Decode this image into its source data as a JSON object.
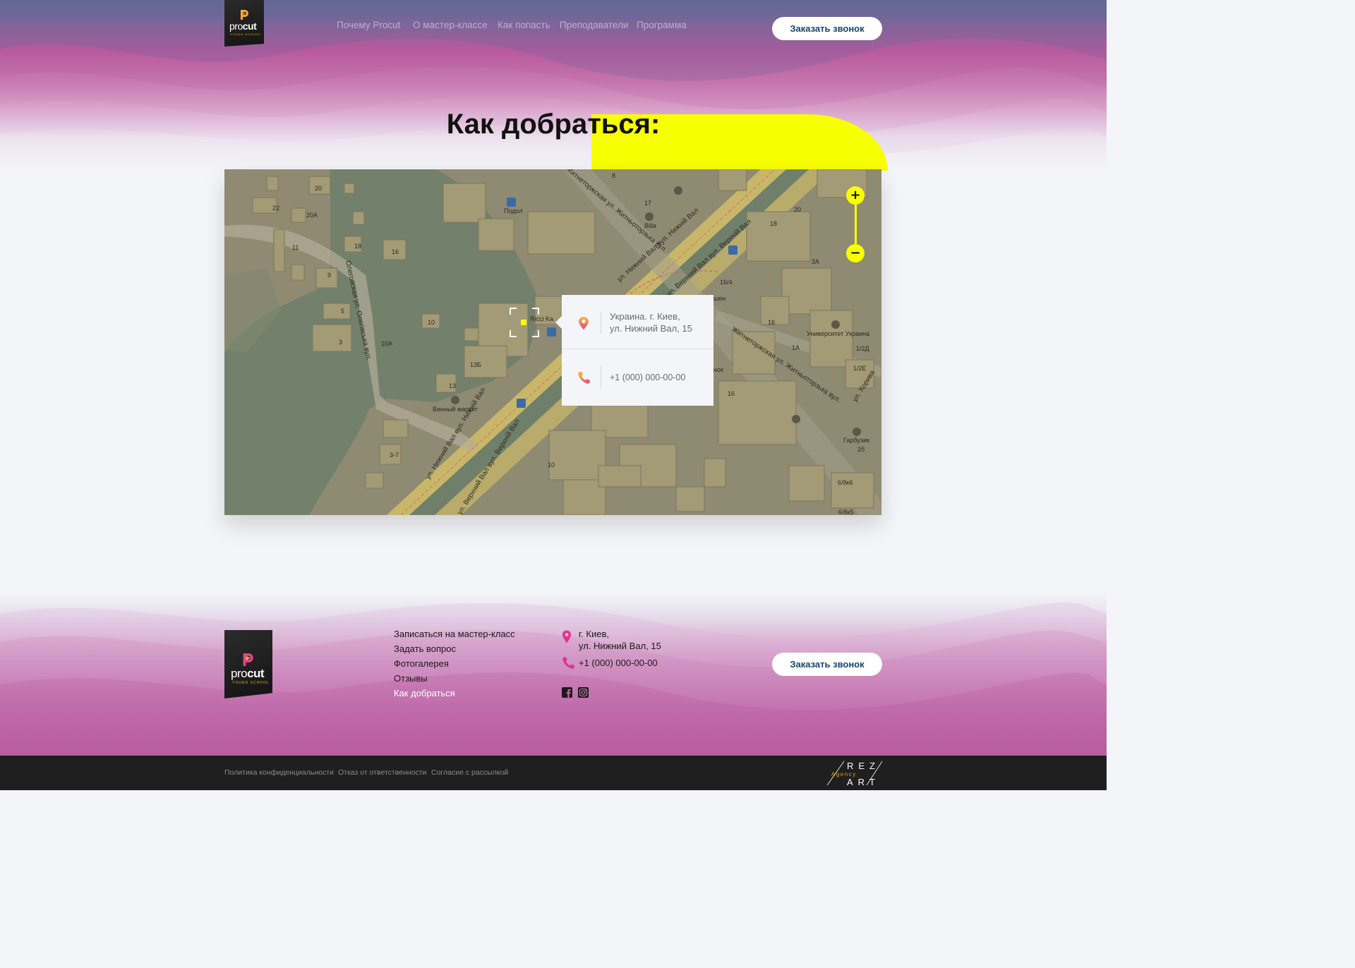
{
  "brand": {
    "name_light": "pro",
    "name_bold": "cut",
    "tagline": "YOUNG SCHOOL"
  },
  "nav": {
    "items": [
      {
        "label": "Почему Procut"
      },
      {
        "label": "О мастер-классе"
      },
      {
        "label": "Как попасть"
      },
      {
        "label": "Преподаватели"
      },
      {
        "label": "Программа"
      }
    ],
    "callback_label": "Заказать звонок"
  },
  "section": {
    "title": "Как добраться:"
  },
  "map": {
    "zoom_in": "+",
    "zoom_out": "−",
    "info": {
      "address_line1": "Украина. г. Киев,",
      "address_line2": "ул. Нижний Вал, 15",
      "phone": "+1 (000) 000-00-00"
    },
    "labels": [
      "20",
      "22",
      "20А",
      "11",
      "18",
      "16",
      "9",
      "5",
      "3",
      "10",
      "10А",
      "13Б",
      "13",
      "3-7",
      "10",
      "8",
      "17",
      "18",
      "20",
      "3А",
      "16/4",
      "16",
      "1А",
      "1/2Д",
      "1/2Е",
      "16",
      "2б",
      "6/8к6",
      "6/8к5",
      "Подол",
      "Billa",
      "Ricci Ka",
      "Винный маркет",
      "Университет Украина",
      "Гарбузик",
      "шен",
      "нок",
      "Олеговская ул. Олегівська вул.",
      "ул. Нижний Вал вул. Нижній Вал",
      "ул. Верхний Вал вул. Верхній Вал",
      "ул. Нижний Вал вул. Нижній Вал",
      "ул. Верхний Вал вул. Верхній Вал",
      "Житнеторжская ул. Житньоторзька вул.",
      "Житнеторжская ул. Житньоторзька вул.",
      "ул. Хорива"
    ]
  },
  "footer": {
    "links": [
      {
        "label": "Записаться на мастер-класс"
      },
      {
        "label": "Задать вопрос"
      },
      {
        "label": "Фотогалерея"
      },
      {
        "label": "Отзывы"
      },
      {
        "label": "Как добраться"
      }
    ],
    "address_line1": "г. Киев,",
    "address_line2": "ул. Нижний Вал, 15",
    "phone": "+1 (000) 000-00-00",
    "callback_label": "Заказать звонок"
  },
  "bottom": {
    "legal": [
      {
        "label": "Политика конфиденциальности"
      },
      {
        "label": "Отказ от ответственности"
      },
      {
        "label": "Согласие с рассылкой"
      }
    ],
    "agency_top": "REZ",
    "agency_mid": "Agency",
    "agency_bottom": "ART"
  },
  "colors": {
    "accent": "#f7ff00",
    "dark": "#1f1f1f",
    "brand_blue": "#17456e",
    "pink": "#e0358f"
  }
}
